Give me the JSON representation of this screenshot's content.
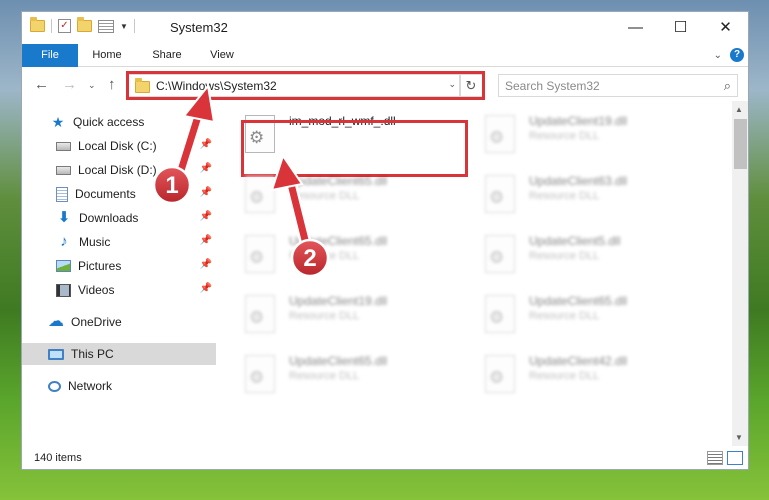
{
  "window": {
    "title": "System32",
    "controls": {
      "minimize": "—",
      "maximize": "☐",
      "close": "✕"
    }
  },
  "ribbon": {
    "tabs": [
      {
        "label": "File"
      },
      {
        "label": "Home"
      },
      {
        "label": "Share"
      },
      {
        "label": "View"
      }
    ],
    "accent": "#1979ca"
  },
  "navigation": {
    "address": "C:\\Windows\\System32",
    "search_placeholder": "Search System32"
  },
  "sidebar": {
    "items": [
      {
        "label": "Quick access",
        "icon": "star-icon"
      },
      {
        "label": "Local Disk (C:)",
        "icon": "disk-icon",
        "pinned": true
      },
      {
        "label": "Local Disk (D:)",
        "icon": "disk-icon",
        "pinned": true
      },
      {
        "label": "Documents",
        "icon": "documents-icon",
        "pinned": true
      },
      {
        "label": "Downloads",
        "icon": "download-icon",
        "pinned": true
      },
      {
        "label": "Music",
        "icon": "music-icon",
        "pinned": true
      },
      {
        "label": "Pictures",
        "icon": "pictures-icon",
        "pinned": true
      },
      {
        "label": "Videos",
        "icon": "videos-icon",
        "pinned": true
      },
      {
        "label": "OneDrive",
        "icon": "cloud-icon"
      },
      {
        "label": "This PC",
        "icon": "pc-icon",
        "selected": true
      },
      {
        "label": "Network",
        "icon": "network-icon"
      }
    ]
  },
  "files": [
    {
      "name": "im_mod_rl_wmf_.dll",
      "type": "",
      "highlighted": true
    },
    {
      "name": "UpdateClient19.dll",
      "type": "Resource DLL"
    },
    {
      "name": "UpdateClient65.dll",
      "type": "Resource DLL"
    },
    {
      "name": "UpdateClient63.dll",
      "type": "Resource DLL"
    },
    {
      "name": "UpdateClient65.dll",
      "type": "Resource DLL"
    },
    {
      "name": "UpdateClient5.dll",
      "type": "Resource DLL"
    },
    {
      "name": "UpdateClient19.dll",
      "type": "Resource DLL"
    },
    {
      "name": "UpdateClient65.dll",
      "type": "Resource DLL"
    },
    {
      "name": "UpdateClient65.dll",
      "type": "Resource DLL"
    },
    {
      "name": "UpdateClient42.dll",
      "type": "Resource DLL"
    }
  ],
  "status": {
    "item_count": "140 items"
  },
  "annotations": {
    "color": "#d9343a",
    "badges": [
      "1",
      "2"
    ]
  }
}
